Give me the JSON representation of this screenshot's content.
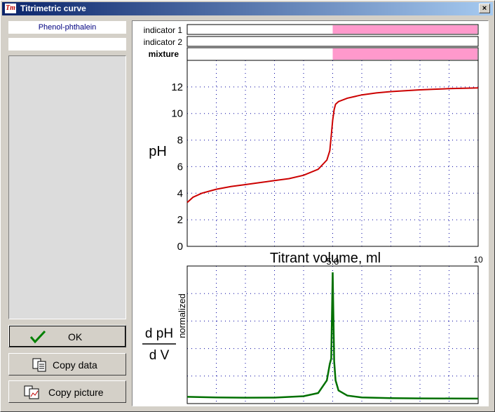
{
  "window": {
    "title": "Titrimetric curve",
    "close_symbol": "×",
    "app_icon_text": "Tm"
  },
  "left_panel": {
    "indicator_name": "Phenol-phthalein",
    "indicator_name_2": ""
  },
  "buttons": {
    "ok": "OK",
    "copy_data": "Copy data",
    "copy_picture": "Copy picture"
  },
  "colors": {
    "titration_curve": "#cc0000",
    "derivative_curve": "#007000",
    "indicator_color": "#ff99cc",
    "grid": "#0000a0"
  },
  "indicator_bars": {
    "labels": {
      "indicator1": "indicator 1",
      "indicator2": "indicator 2",
      "mixture": "mixture"
    },
    "colored_from_volume": 5.0
  },
  "chart_data": [
    {
      "type": "line",
      "title": "",
      "xlabel": "Titrant volume, ml",
      "ylabel": "pH",
      "xlim": [
        0,
        10
      ],
      "ylim": [
        0,
        14
      ],
      "x_tick_labels": [
        "10"
      ],
      "y_tick_labels": [
        "0",
        "2",
        "4",
        "6",
        "8",
        "10",
        "12"
      ],
      "grid": true,
      "series": [
        {
          "x": [
            0,
            0.2,
            0.5,
            1,
            1.5,
            2,
            2.5,
            3,
            3.5,
            4,
            4.5,
            4.8,
            4.9,
            4.95,
            5.0,
            5.05,
            5.1,
            5.2,
            5.5,
            6,
            6.5,
            7,
            7.5,
            8,
            8.5,
            9,
            9.5,
            10
          ],
          "y": [
            3.3,
            3.7,
            4.0,
            4.3,
            4.5,
            4.65,
            4.8,
            4.95,
            5.1,
            5.35,
            5.8,
            6.5,
            7.2,
            8.3,
            9.5,
            10.3,
            10.7,
            10.9,
            11.15,
            11.4,
            11.55,
            11.65,
            11.72,
            11.78,
            11.83,
            11.87,
            11.9,
            11.93
          ]
        }
      ]
    },
    {
      "type": "line",
      "title": "",
      "xlabel": "",
      "ylabel": "normalized",
      "ylabel_fraction_numerator": "d pH",
      "ylabel_fraction_denominator": "d V",
      "xlim": [
        0,
        10
      ],
      "ylim": [
        0,
        1.05
      ],
      "grid": true,
      "annotations": [
        {
          "x": 5.0,
          "text": "5.0"
        }
      ],
      "series": [
        {
          "x": [
            0,
            1,
            2,
            3,
            4,
            4.5,
            4.8,
            4.9,
            4.95,
            5.0,
            5.05,
            5.1,
            5.2,
            5.5,
            6,
            7,
            8,
            9,
            10
          ],
          "y": [
            0.02,
            0.015,
            0.013,
            0.014,
            0.025,
            0.05,
            0.15,
            0.28,
            0.32,
            1.0,
            0.3,
            0.15,
            0.07,
            0.03,
            0.015,
            0.01,
            0.008,
            0.007,
            0.006
          ]
        }
      ]
    }
  ]
}
